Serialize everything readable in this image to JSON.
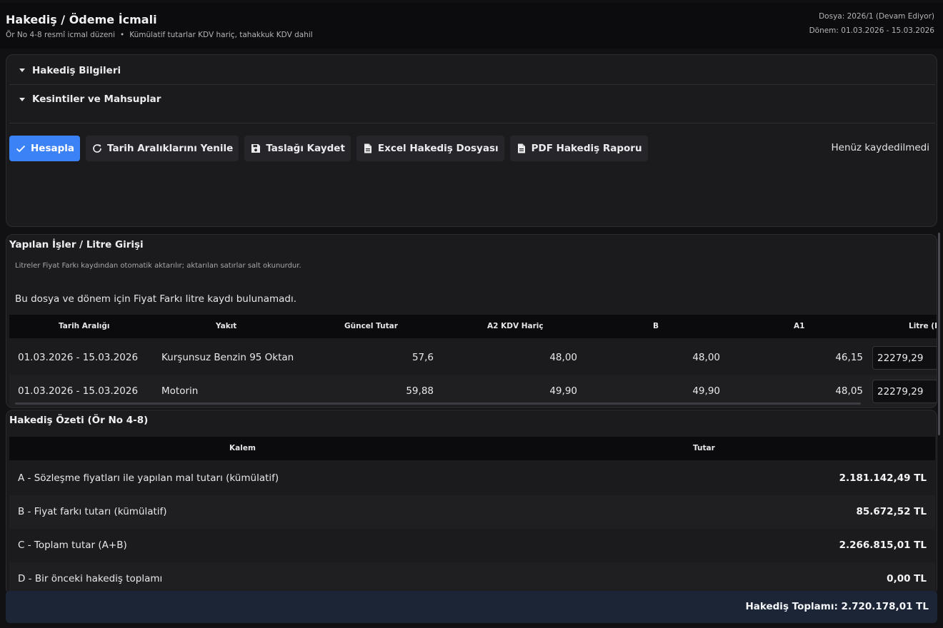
{
  "header": {
    "title": "Hakediş / Ödeme İcmali",
    "subtitle_left": "Ör No 4-8 resmî icmal düzeni",
    "subtitle_sep": "•",
    "subtitle_right": "Kümülatif tutarlar KDV hariç, tahakkuk KDV dahil",
    "file": "Dosya: 2026/1 (Devam Ediyor)",
    "period": "Dönem: 01.03.2026 - 15.03.2026"
  },
  "sections": {
    "info": "Hakediş Bilgileri",
    "deductions": "Kesintiler ve Mahsuplar"
  },
  "toolbar": {
    "calculate": "Hesapla",
    "refresh": "Tarih Aralıklarını Yenile",
    "save_draft": "Taslağı Kaydet",
    "excel": "Excel Hakediş Dosyası",
    "pdf": "PDF Hakediş Raporu",
    "status": "Henüz kaydedilmedi"
  },
  "works": {
    "title": "Yapılan İşler / Litre Girişi",
    "note": "Litreler Fiyat Farkı kaydından otomatik aktarılır; aktarılan satırlar salt okunurdur.",
    "empty": "Bu dosya ve dönem için Fiyat Farkı litre kaydı bulunamadı.",
    "columns": [
      "Tarih Aralığı",
      "Yakıt",
      "Güncel Tutar",
      "A2 KDV Hariç",
      "B",
      "A1",
      "Litre (F"
    ],
    "rows": [
      {
        "date": "01.03.2026 - 15.03.2026",
        "fuel": "Kurşunsuz Benzin 95 Oktan",
        "current": "57,6",
        "a2": "48,00",
        "b": "48,00",
        "a1": "46,15",
        "litre": "22279,29"
      },
      {
        "date": "01.03.2026 - 15.03.2026",
        "fuel": "Motorin",
        "current": "59,88",
        "a2": "49,90",
        "b": "49,90",
        "a1": "48,05",
        "litre": "22279,29"
      }
    ]
  },
  "summary": {
    "title": "Hakediş Özeti (Ör No 4-8)",
    "col_item": "Kalem",
    "col_amount": "Tutar",
    "rows": [
      {
        "label": "A - Sözleşme fiyatları ile yapılan mal tutarı (kümülatif)",
        "amount": "2.181.142,49 TL"
      },
      {
        "label": "B - Fiyat farkı tutarı (kümülatif)",
        "amount": "85.672,52 TL"
      },
      {
        "label": "C - Toplam tutar (A+B)",
        "amount": "2.266.815,01 TL"
      },
      {
        "label": "D - Bir önceki hakediş toplamı",
        "amount": "0,00 TL"
      }
    ]
  },
  "footer": {
    "total": "Hakediş Toplamı: 2.720.178,01 TL"
  },
  "colors": {
    "primary": "#3b82f6",
    "footer_bg": "#1c2535"
  }
}
